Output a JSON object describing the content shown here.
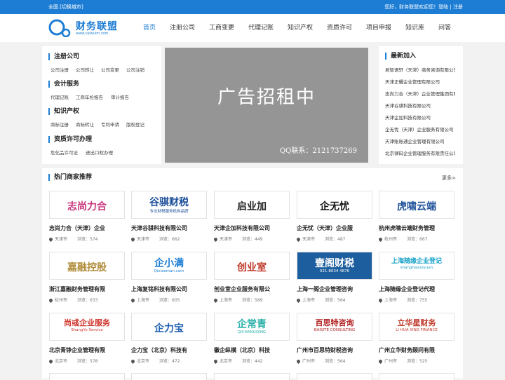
{
  "topbar": {
    "left": "全国 [切换城市]",
    "right": "您好，财务联盟欢迎您！登陆 | 注册"
  },
  "logo": {
    "name": "财务联盟",
    "url": "www.caiwulm.com"
  },
  "nav": [
    "首页",
    "注册公司",
    "工商变更",
    "代理记账",
    "知识产权",
    "资质许可",
    "项目申报",
    "知识库",
    "问答"
  ],
  "categories": [
    {
      "title": "注册公司",
      "links": [
        "公司注册",
        "公司转让",
        "公司变更",
        "公司注销"
      ]
    },
    {
      "title": "会计服务",
      "links": [
        "代理记账",
        "工商年检报告",
        "审计报告"
      ]
    },
    {
      "title": "知识产权",
      "links": [
        "商标注册",
        "商标转让",
        "专利申请",
        "版权登记"
      ]
    },
    {
      "title": "资质许可办理",
      "links": [
        "危化品许可证",
        "进出口权办理"
      ]
    }
  ],
  "ad": {
    "title": "广告招租中",
    "contact": "QQ联系：2121737269"
  },
  "news": {
    "title": "最新加入",
    "items": [
      "君智语轩（天津）商务咨询有限公司",
      "天津正耀企业管理有限公司",
      "志尚力合（天津）企业管理集团有限公司",
      "天津谷骐科技有限公司",
      "天津企加科技有限公司",
      "企无忧（天津）企业服务有限公司",
      "天津账账通企业管理有限公司",
      "北京律码企业管理服务有限责任公司"
    ]
  },
  "hot": {
    "title": "热门商家推荐",
    "more": "更多>"
  },
  "view_label": "浏览：",
  "merchants": [
    {
      "name": "志尚力合（天津）企业",
      "city": "天津市",
      "views": "574",
      "logo": "志尚力合",
      "color": "#c8357b"
    },
    {
      "name": "天津谷骐科技有限公司",
      "city": "天津市",
      "views": "662",
      "logo": "谷骐财税",
      "sub": "专业财税服务机构品牌",
      "color": "#1d4f9a"
    },
    {
      "name": "天津企加科技有限公司",
      "city": "天津市",
      "views": "449",
      "logo": "启业加",
      "color": "#222222"
    },
    {
      "name": "企无忧（天津）企业服",
      "city": "天津市",
      "views": "487",
      "logo": "企无忧",
      "color": "#111111"
    },
    {
      "name": "杭州虎啸云端财务管理",
      "city": "杭州市",
      "views": "667",
      "logo": "虎啸云端",
      "color": "#1d4f9a"
    },
    {
      "name": "浙江嘉融财务管理有限",
      "city": "杭州市",
      "views": "633",
      "logo": "嘉融控股",
      "color": "#b08d3a"
    },
    {
      "name": "上海复铭科技有限公司",
      "city": "上海市",
      "views": "605",
      "logo": "企小满",
      "sub": "Qixiaoman.com",
      "color": "#1d7dd4"
    },
    {
      "name": "创业室企业服务有限公",
      "city": "上海市",
      "views": "589",
      "logo": "创业室",
      "color": "#c0392b"
    },
    {
      "name": "上海一阁企业管理咨询",
      "city": "上海市",
      "views": "564",
      "logo": "壹阁财税",
      "sub": "021-8034 4876",
      "color": "#ffffff"
    },
    {
      "name": "上海随缘企业登记代理",
      "city": "上海市",
      "views": "755",
      "logo": "上海随缘企业登记",
      "sub": "shanghaisuiyuan",
      "color": "#1aa3c8"
    },
    {
      "name": "北京青铮企业管理有限",
      "city": "北京市",
      "views": "578",
      "logo": "尚彧企业服务",
      "sub": "ShangYu Service",
      "color": "#d0342c"
    },
    {
      "name": "企力宝（北京）科技有",
      "city": "北京市",
      "views": "472",
      "logo": "企力宝",
      "color": "#1d5fb0"
    },
    {
      "name": "徽企纵横（北京）科技",
      "city": "北京市",
      "views": "442",
      "logo": "企常青",
      "sub": "QICHANGQING",
      "color": "#2bb0a8"
    },
    {
      "name": "广州市百思特财税咨询",
      "city": "广州市",
      "views": "564",
      "logo": "百思特咨询",
      "sub": "BAISITE CONSULTING",
      "color": "#b22222"
    },
    {
      "name": "广州立华财务顾问有限",
      "city": "广州市",
      "views": "525",
      "logo": "立华星财务",
      "sub": "LI HUA XING FINANCE",
      "color": "#c0392b"
    }
  ]
}
